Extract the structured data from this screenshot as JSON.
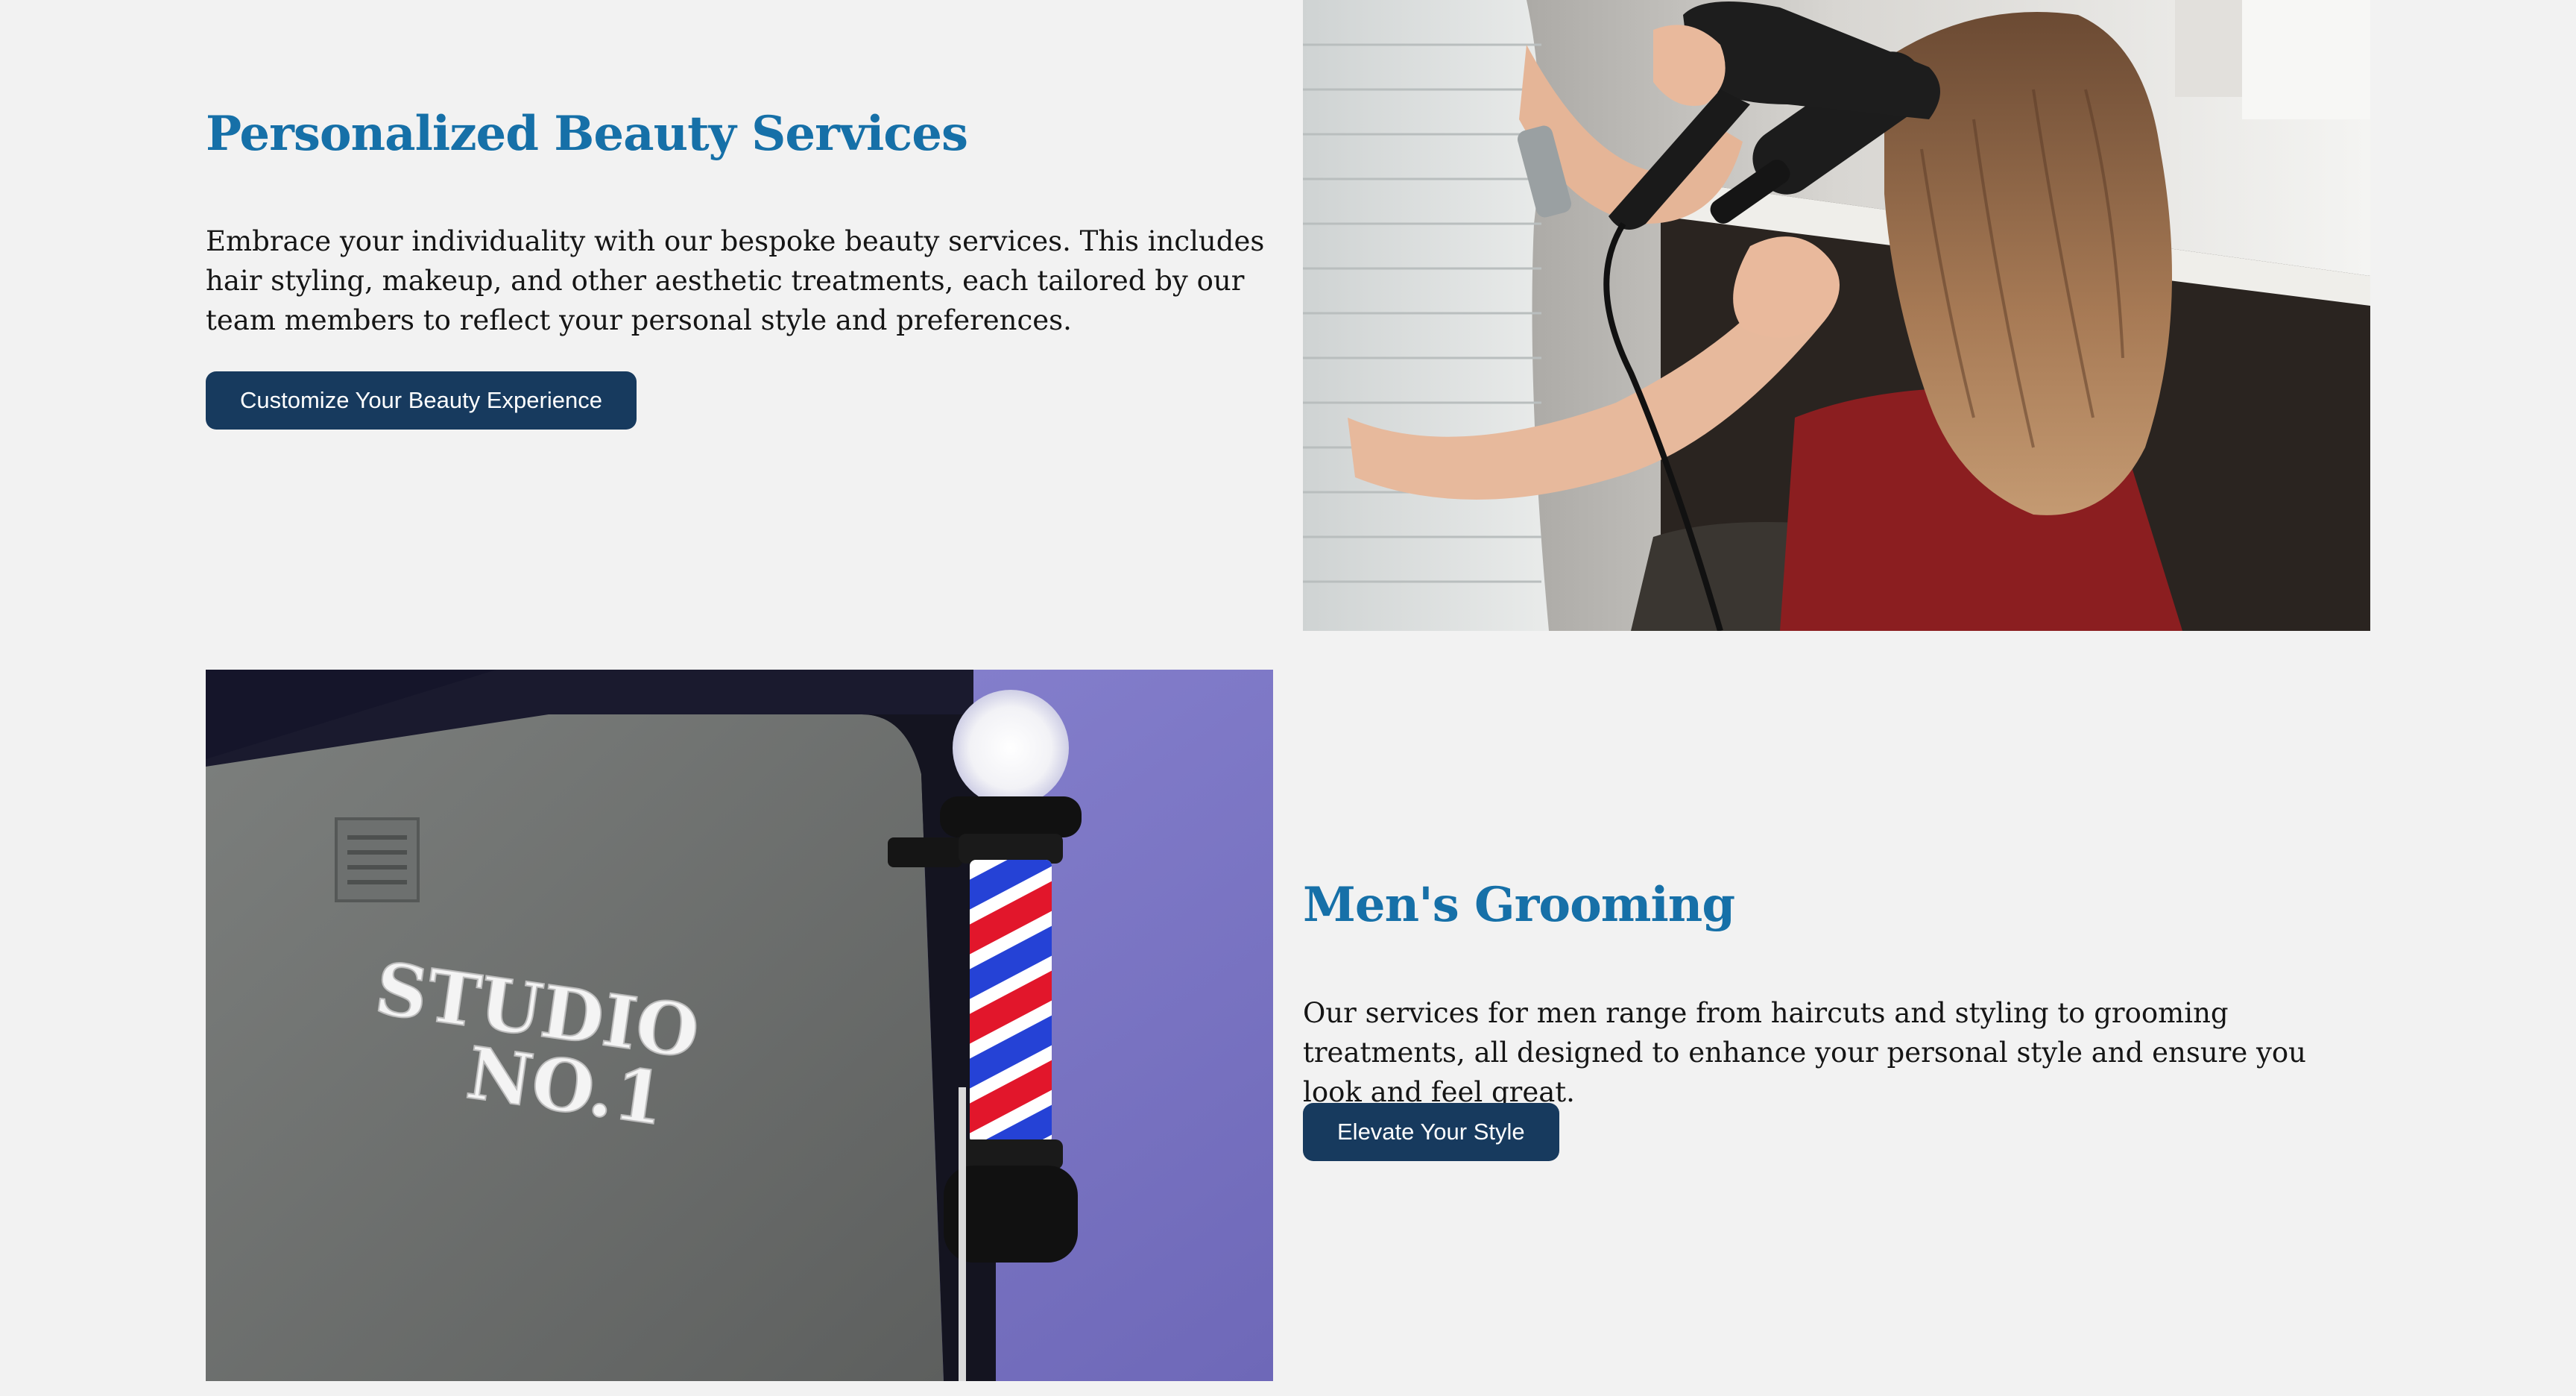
{
  "sections": [
    {
      "title": "Personalized Beauty Services",
      "description": "Embrace your individuality with our bespoke beauty services. This includes hair styling, makeup, and other aesthetic treatments, each tailored by our team members to reflect your personal style and preferences.",
      "button_label": "Customize Your Beauty Experience",
      "image": "hair-stylist-blow-drying-photo"
    },
    {
      "title": "Men's Grooming",
      "description": "Our services for men range from haircuts and styling to grooming treatments, all designed to enhance your personal style and ensure you look and feel great.",
      "button_label": "Elevate Your Style",
      "image": "barber-pole-studio-sign-photo",
      "sign_text": [
        "STUDIO",
        "NO.1"
      ]
    }
  ],
  "colors": {
    "background": "#f2f2f2",
    "heading": "#1670a8",
    "body_text": "#151515",
    "button_bg": "#173a5e",
    "button_text": "#ffffff"
  }
}
